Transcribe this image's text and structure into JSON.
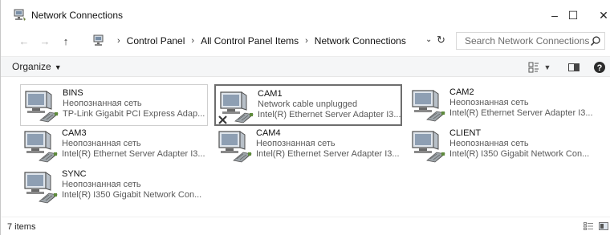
{
  "window": {
    "title": "Network Connections",
    "controls": {
      "minimize": "–",
      "maximize": "☐",
      "close": "✕"
    }
  },
  "navigation": {
    "breadcrumbs": [
      "Control Panel",
      "All Control Panel Items",
      "Network Connections"
    ],
    "separator": "›",
    "search_placeholder": "Search Network Connections"
  },
  "toolbar": {
    "organize_label": "Organize"
  },
  "connections": [
    {
      "name": "BINS",
      "status": "Неопознанная сеть",
      "adapter": "TP-Link Gigabit PCI Express Adap...",
      "disconnected": false,
      "state": "selected"
    },
    {
      "name": "CAM1",
      "status": "Network cable unplugged",
      "adapter": "Intel(R) Ethernet Server Adapter I3...",
      "disconnected": true,
      "state": "focused"
    },
    {
      "name": "CAM2",
      "status": "Неопознанная сеть",
      "adapter": "Intel(R) Ethernet Server Adapter I3...",
      "disconnected": false,
      "state": "normal"
    },
    {
      "name": "CAM3",
      "status": "Неопознанная сеть",
      "adapter": "Intel(R) Ethernet Server Adapter I3...",
      "disconnected": false,
      "state": "normal"
    },
    {
      "name": "CAM4",
      "status": "Неопознанная сеть",
      "adapter": "Intel(R) Ethernet Server Adapter I3...",
      "disconnected": false,
      "state": "normal"
    },
    {
      "name": "CLIENT",
      "status": "Неопознанная сеть",
      "adapter": "Intel(R) I350 Gigabit Network Con...",
      "disconnected": false,
      "state": "normal"
    },
    {
      "name": "SYNC",
      "status": "Неопознанная сеть",
      "adapter": "Intel(R) I350 Gigabit Network Con...",
      "disconnected": false,
      "state": "normal"
    }
  ],
  "statusbar": {
    "item_count": "7 items"
  }
}
